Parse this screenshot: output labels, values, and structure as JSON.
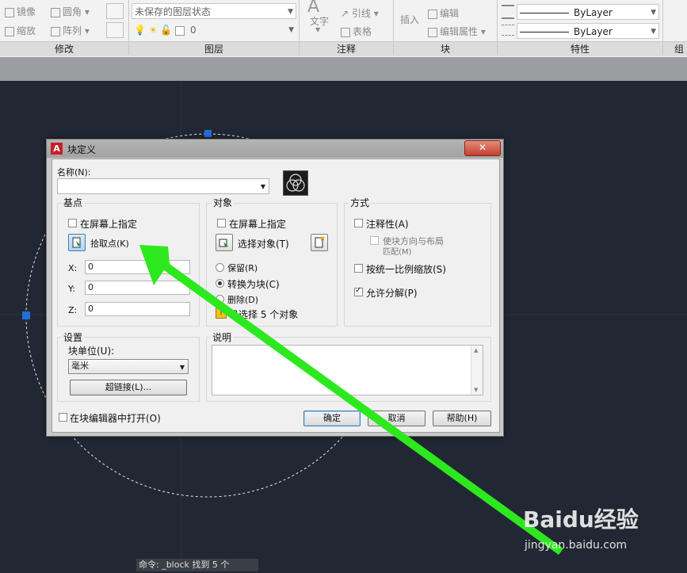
{
  "ribbon": {
    "modify": {
      "mirror": "镜像",
      "fillet": "圆角",
      "scale": "缩放",
      "array": "阵列",
      "panel_label": "修改"
    },
    "layer": {
      "layer_state": "未保存的图层状态",
      "current_layer": "0",
      "panel_label": "图层"
    },
    "annotation": {
      "text": "文字",
      "leader": "引线",
      "table": "表格",
      "panel_label": "注释"
    },
    "block": {
      "insert": "插入",
      "edit": "编辑",
      "edit_attributes": "编辑属性",
      "panel_label": "块"
    },
    "properties": {
      "color": "ByLayer",
      "linetype": "ByLayer",
      "panel_label": "特性"
    },
    "groups": {
      "panel_label": "组"
    }
  },
  "dialog": {
    "title": "块定义",
    "name_label": "名称(N):",
    "name_value": "",
    "base_point": {
      "group_label": "基点",
      "specify_on_screen": "在屏幕上指定",
      "pick_point": "拾取点(K)",
      "x_label": "X:",
      "x_value": "0",
      "y_label": "Y:",
      "y_value": "0",
      "z_label": "Z:",
      "z_value": "0"
    },
    "objects": {
      "group_label": "对象",
      "specify_on_screen": "在屏幕上指定",
      "select_objects": "选择对象(T)",
      "retain": "保留(R)",
      "convert_to_block": "转换为块(C)",
      "delete": "删除(D)",
      "selected_count": "已选择 5 个对象"
    },
    "behavior": {
      "group_label": "方式",
      "annotative": "注释性(A)",
      "match_orientation": "使块方向与布局",
      "match_orientation_2": "匹配(M)",
      "scale_uniformly": "按统一比例缩放(S)",
      "allow_exploding": "允许分解(P)"
    },
    "settings": {
      "group_label": "设置",
      "block_unit_label": "块单位(U):",
      "block_unit_value": "毫米",
      "hyperlink": "超链接(L)..."
    },
    "description": {
      "group_label": "说明",
      "value": ""
    },
    "open_in_editor": "在块编辑器中打开(O)",
    "ok": "确定",
    "cancel": "取消",
    "help": "帮助(H)"
  },
  "command_line": "命令: _block 找到 5 个",
  "watermark": {
    "brand": "Baidu经验",
    "url": "jingyan.baidu.com"
  },
  "colors": {
    "canvas": "#222833",
    "arrow": "#2ee81f",
    "grip": "#1e6fd9",
    "dialog_face": "#f0f0f0"
  }
}
